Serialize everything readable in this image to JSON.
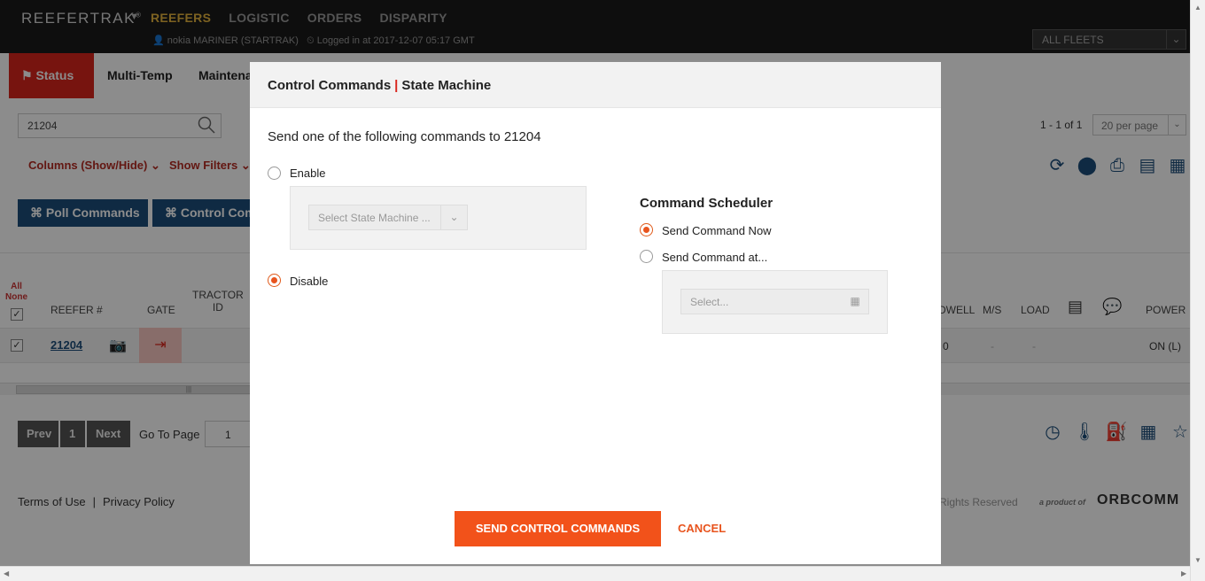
{
  "header": {
    "brand": "REEFERTRAK",
    "brand_mark": "®",
    "nav": [
      "REEFERS",
      "LOGISTIC",
      "ORDERS",
      "DISPARITY"
    ],
    "user": "nokia MARINER (STARTRAK)",
    "login_info": "Logged in at 2017-12-07 05:17 GMT",
    "fleet_select": "ALL FLEETS",
    "accent_color": "#e3b23c"
  },
  "tabs": [
    "Status",
    "Multi-Temp",
    "Maintena"
  ],
  "search": {
    "value": "21204"
  },
  "pagination_info": "1 - 1 of 1",
  "per_page": "20 per page",
  "filters": {
    "columns": "Columns (Show/Hide)",
    "show_filters": "Show Filters"
  },
  "buttons": {
    "poll": "⌘ Poll Commands",
    "control": "⌘ Control Com"
  },
  "table": {
    "all": "All",
    "none": "None",
    "headers": {
      "reefer": "REEFER #",
      "gate": "GATE",
      "tractor": "TRACTOR",
      "tractor_id": "ID",
      "dwell": "DWELL",
      "ms": "M/S",
      "load": "LOAD",
      "power": "POWER"
    },
    "row": {
      "reefer": "21204",
      "dwell": "0",
      "ms": "-",
      "load": "-",
      "power": "ON (L)"
    }
  },
  "pager": {
    "prev": "Prev",
    "page": "1",
    "next": "Next",
    "goto_label": "Go To Page",
    "goto_value": "1"
  },
  "footer": {
    "terms": "Terms of Use",
    "separator": "|",
    "privacy": "Privacy Policy",
    "rights": "Rights Reserved",
    "product_of": "a product of",
    "company": "ORBCOMM"
  },
  "modal": {
    "title_part1": "Control Commands",
    "title_sep": "|",
    "title_part2": "State Machine",
    "prompt": "Send one of the following commands to 21204",
    "enable_label": "Enable",
    "state_machine_placeholder": "Select State Machine ...",
    "disable_label": "Disable",
    "scheduler_title": "Command Scheduler",
    "send_now_label": "Send Command Now",
    "send_at_label": "Send Command at...",
    "date_placeholder": "Select...",
    "send_button": "SEND CONTROL COMMANDS",
    "cancel_button": "CANCEL",
    "selected_command": "Disable",
    "selected_schedule": "Send Command Now",
    "accent_color": "#f2521a"
  }
}
